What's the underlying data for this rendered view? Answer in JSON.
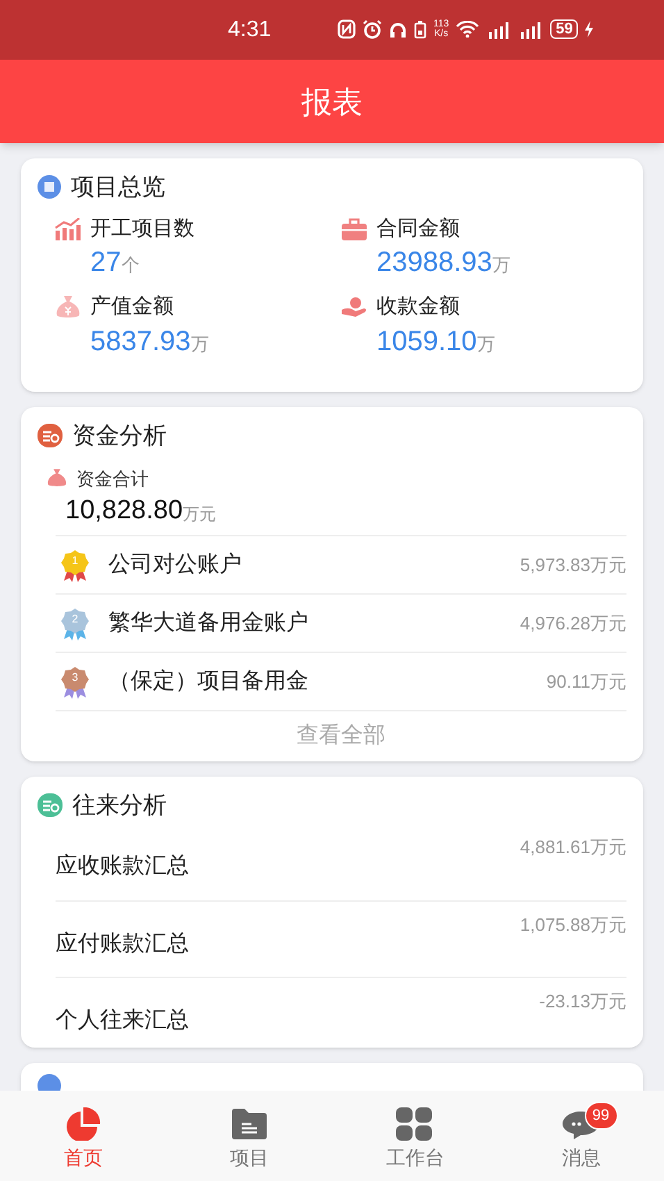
{
  "status_bar": {
    "time": "4:31",
    "speed_value": "113",
    "speed_unit": "K/s",
    "battery": "59"
  },
  "header": {
    "title": "报表"
  },
  "overview": {
    "title": "项目总览",
    "stats": [
      {
        "label": "开工项目数",
        "value": "27",
        "unit": "个"
      },
      {
        "label": "合同金额",
        "value": "23988.93",
        "unit": "万"
      },
      {
        "label": "产值金额",
        "value": "5837.93",
        "unit": "万"
      },
      {
        "label": "收款金额",
        "value": "1059.10",
        "unit": "万"
      }
    ]
  },
  "funds": {
    "title": "资金分析",
    "total_label": "资金合计",
    "total_value": "10,828.80",
    "total_unit": "万元",
    "accounts": [
      {
        "rank": "1",
        "name": "公司对公账户",
        "amount": "5,973.83万元"
      },
      {
        "rank": "2",
        "name": "繁华大道备用金账户",
        "amount": "4,976.28万元"
      },
      {
        "rank": "3",
        "name": "（保定）项目备用金",
        "amount": "90.11万元"
      }
    ],
    "view_all": "查看全部"
  },
  "dealings": {
    "title": "往来分析",
    "rows": [
      {
        "label": "应收账款汇总",
        "amount": "4,881.61万元"
      },
      {
        "label": "应付账款汇总",
        "amount": "1,075.88万元"
      },
      {
        "label": "个人往来汇总",
        "amount": "-23.13万元"
      }
    ]
  },
  "tabs": [
    {
      "label": "首页",
      "selected": true
    },
    {
      "label": "项目",
      "selected": false
    },
    {
      "label": "工作台",
      "selected": false
    },
    {
      "label": "消息",
      "selected": false,
      "badge": "99"
    }
  ]
}
